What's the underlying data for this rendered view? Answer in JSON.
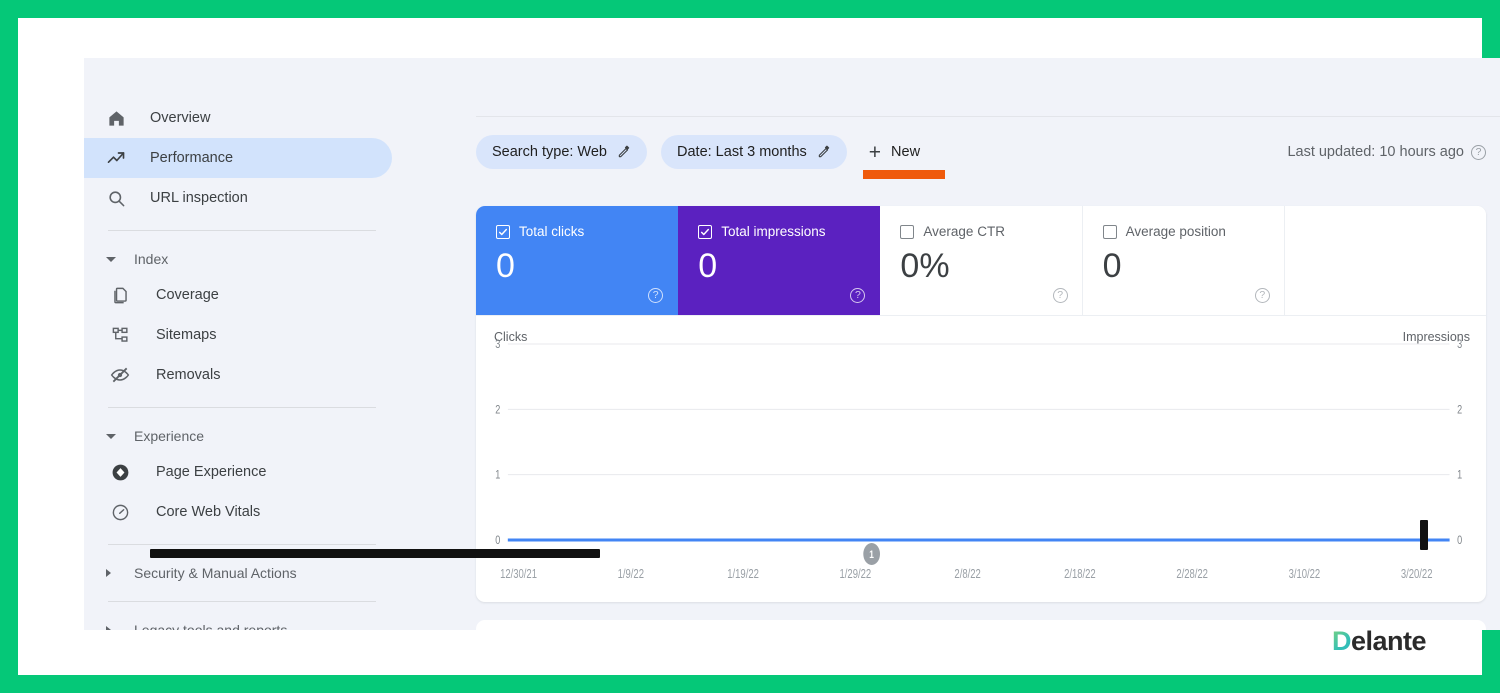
{
  "sidebar": {
    "items": [
      {
        "label": "Overview",
        "icon": "home-icon",
        "key": "overview",
        "active": false
      },
      {
        "label": "Performance",
        "icon": "trending-up-icon",
        "key": "performance",
        "active": true
      },
      {
        "label": "URL inspection",
        "icon": "search-icon",
        "key": "url-inspection",
        "active": false
      }
    ],
    "groups": [
      {
        "label": "Index",
        "expanded": true,
        "items": [
          {
            "label": "Coverage",
            "icon": "pages-icon",
            "key": "coverage"
          },
          {
            "label": "Sitemaps",
            "icon": "sitemap-icon",
            "key": "sitemaps"
          },
          {
            "label": "Removals",
            "icon": "eye-off-icon",
            "key": "removals"
          }
        ]
      },
      {
        "label": "Experience",
        "expanded": true,
        "items": [
          {
            "label": "Page Experience",
            "icon": "diamond-icon",
            "key": "page-experience"
          },
          {
            "label": "Core Web Vitals",
            "icon": "speedometer-icon",
            "key": "core-web-vitals"
          }
        ]
      },
      {
        "label": "Security & Manual Actions",
        "expanded": false,
        "items": []
      },
      {
        "label": "Legacy tools and reports",
        "expanded": false,
        "items": []
      }
    ]
  },
  "toolbar": {
    "search_type_chip": "Search type: Web",
    "date_chip": "Date: Last 3 months",
    "new_label": "New",
    "plus_glyph": "+",
    "last_updated": "Last updated: 10 hours ago",
    "accent_color": "#ef5a0c"
  },
  "metrics": [
    {
      "label": "Total clicks",
      "value": "0",
      "checked": true,
      "color": "#4285f4"
    },
    {
      "label": "Total impressions",
      "value": "0",
      "checked": true,
      "color": "#5b21c0"
    },
    {
      "label": "Average CTR",
      "value": "0%",
      "checked": false,
      "color": "#ffffff"
    },
    {
      "label": "Average position",
      "value": "0",
      "checked": false,
      "color": "#ffffff"
    }
  ],
  "chart_data": {
    "type": "line",
    "title": "",
    "left_axis_label": "Clicks",
    "right_axis_label": "Impressions",
    "yticks": [
      "3",
      "2",
      "1",
      "0"
    ],
    "ylim": [
      0,
      3
    ],
    "grid": true,
    "categories": [
      "12/30/21",
      "1/9/22",
      "1/19/22",
      "1/29/22",
      "2/8/22",
      "2/18/22",
      "2/28/22",
      "3/10/22",
      "3/20/22"
    ],
    "series": [
      {
        "name": "Clicks",
        "color": "#4285f4",
        "values": [
          0,
          0,
          0,
          0,
          0,
          0,
          0,
          0,
          0
        ]
      },
      {
        "name": "Impressions",
        "color": "#5b21c0",
        "values": [
          0,
          0,
          0,
          0,
          0,
          0,
          0,
          0,
          0
        ]
      }
    ],
    "annotations": [
      {
        "label": "1",
        "near_category": "1/29/22"
      }
    ]
  },
  "branding": {
    "logo_first_letter": "D",
    "logo_rest": "elante"
  }
}
